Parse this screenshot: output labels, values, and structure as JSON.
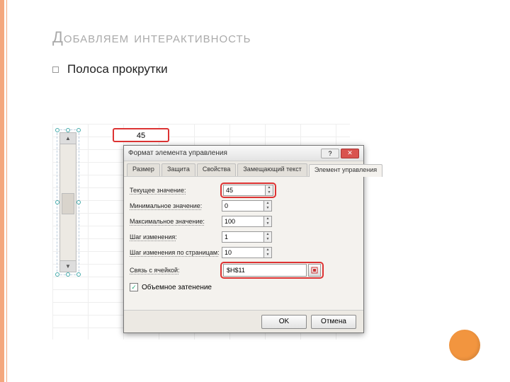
{
  "slide": {
    "title": "Добавляем интерактивность",
    "bullet": "Полоса прокрутки"
  },
  "cell": {
    "value": "45"
  },
  "dialog": {
    "title": "Формат элемента управления",
    "tabs": {
      "size": "Размер",
      "protection": "Защита",
      "properties": "Свойства",
      "alttext": "Замещающий текст",
      "control": "Элемент управления"
    },
    "fields": {
      "current_label": "Текущее значение:",
      "current_value": "45",
      "min_label": "Минимальное значение:",
      "min_value": "0",
      "max_label": "Максимальное значение:",
      "max_value": "100",
      "step_label": "Шаг изменения:",
      "step_value": "1",
      "page_label": "Шаг изменения по страницам:",
      "page_value": "10",
      "link_label": "Связь с ячейкой:",
      "link_value": "$H$11",
      "shade_label": "Объемное затенение"
    },
    "buttons": {
      "ok": "OK",
      "cancel": "Отмена"
    }
  }
}
